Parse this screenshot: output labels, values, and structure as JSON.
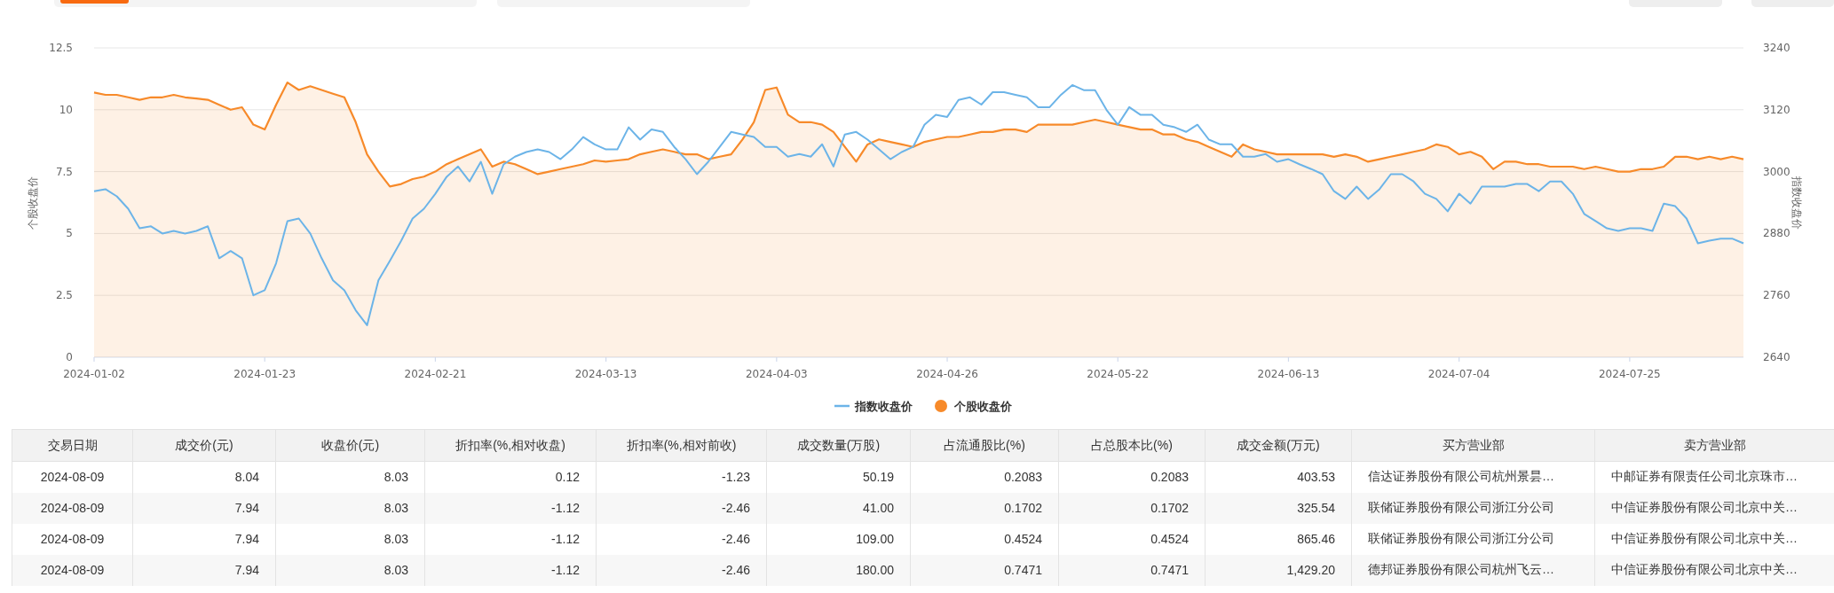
{
  "chart": {
    "chart_data": {
      "type": "line",
      "grid": true,
      "legend": "bottom",
      "ylabel": "个股收盘价",
      "y2label": "指数收盘价",
      "ylim": [
        0,
        12.5
      ],
      "y2lim": [
        2640,
        3240
      ],
      "yticks": [
        0,
        2.5,
        5,
        7.5,
        10,
        12.5
      ],
      "y2ticks": [
        2640,
        2760,
        2880,
        3000,
        3120,
        3240
      ],
      "categories": [
        "2024-01-02",
        null,
        null,
        null,
        null,
        null,
        null,
        null,
        null,
        null,
        null,
        null,
        null,
        null,
        null,
        "2024-01-23",
        null,
        null,
        null,
        null,
        null,
        null,
        null,
        null,
        null,
        null,
        null,
        null,
        null,
        null,
        "2024-02-21",
        null,
        null,
        null,
        null,
        null,
        null,
        null,
        null,
        null,
        null,
        null,
        null,
        null,
        null,
        "2024-03-13",
        null,
        null,
        null,
        null,
        null,
        null,
        null,
        null,
        null,
        null,
        null,
        null,
        null,
        null,
        "2024-04-03",
        null,
        null,
        null,
        null,
        null,
        null,
        null,
        null,
        null,
        null,
        null,
        null,
        null,
        null,
        "2024-04-26",
        null,
        null,
        null,
        null,
        null,
        null,
        null,
        null,
        null,
        null,
        null,
        null,
        null,
        null,
        "2024-05-22",
        null,
        null,
        null,
        null,
        null,
        null,
        null,
        null,
        null,
        null,
        null,
        null,
        null,
        null,
        "2024-06-13",
        null,
        null,
        null,
        null,
        null,
        null,
        null,
        null,
        null,
        null,
        null,
        null,
        null,
        null,
        "2024-07-04",
        null,
        null,
        null,
        null,
        null,
        null,
        null,
        null,
        null,
        null,
        null,
        null,
        null,
        null,
        "2024-07-25",
        null,
        null,
        null,
        null,
        null,
        null,
        null,
        null,
        null,
        null
      ],
      "series": [
        {
          "name": "指数收盘价",
          "type": "line",
          "axis": "y2",
          "color": "#6cb4e8",
          "values": [
            2962,
            2966,
            2952,
            2928,
            2890,
            2894,
            2880,
            2885,
            2880,
            2885,
            2894,
            2832,
            2846,
            2832,
            2760,
            2770,
            2822,
            2904,
            2909,
            2880,
            2832,
            2789,
            2770,
            2731,
            2702,
            2789,
            2827,
            2866,
            2909,
            2928,
            2957,
            2990,
            3010,
            2981,
            3019,
            2957,
            3014,
            3029,
            3038,
            3043,
            3038,
            3024,
            3043,
            3067,
            3053,
            3043,
            3043,
            3086,
            3062,
            3082,
            3077,
            3048,
            3024,
            2995,
            3019,
            3048,
            3077,
            3072,
            3067,
            3048,
            3048,
            3029,
            3034,
            3029,
            3053,
            3010,
            3072,
            3077,
            3062,
            3043,
            3024,
            3038,
            3048,
            3091,
            3110,
            3106,
            3139,
            3144,
            3130,
            3154,
            3154,
            3149,
            3144,
            3125,
            3125,
            3149,
            3168,
            3158,
            3158,
            3120,
            3091,
            3125,
            3110,
            3110,
            3091,
            3086,
            3077,
            3091,
            3062,
            3053,
            3053,
            3029,
            3029,
            3034,
            3019,
            3024,
            3014,
            3005,
            2995,
            2962,
            2947,
            2971,
            2947,
            2966,
            2995,
            2995,
            2981,
            2957,
            2947,
            2923,
            2957,
            2938,
            2971,
            2971,
            2971,
            2976,
            2976,
            2962,
            2981,
            2981,
            2957,
            2918,
            2904,
            2890,
            2885,
            2890,
            2890,
            2885,
            2938,
            2933,
            2909,
            2861,
            2866,
            2870,
            2870,
            2861
          ]
        },
        {
          "name": "个股收盘价",
          "type": "area",
          "color": "#f78a2a",
          "values": [
            10.7,
            10.6,
            10.6,
            10.5,
            10.4,
            10.5,
            10.5,
            10.6,
            10.5,
            10.45,
            10.4,
            10.2,
            10.0,
            10.1,
            9.4,
            9.2,
            10.2,
            11.1,
            10.8,
            10.95,
            10.8,
            10.65,
            10.5,
            9.5,
            8.2,
            7.5,
            6.9,
            7.0,
            7.2,
            7.3,
            7.5,
            7.8,
            8.0,
            8.2,
            8.4,
            7.7,
            7.9,
            7.8,
            7.6,
            7.4,
            7.5,
            7.6,
            7.7,
            7.8,
            7.95,
            7.9,
            7.95,
            8.0,
            8.2,
            8.3,
            8.4,
            8.3,
            8.2,
            8.2,
            8.0,
            8.1,
            8.2,
            8.8,
            9.5,
            10.8,
            10.9,
            9.8,
            9.5,
            9.5,
            9.4,
            9.1,
            8.5,
            7.9,
            8.6,
            8.8,
            8.7,
            8.6,
            8.5,
            8.7,
            8.8,
            8.9,
            8.9,
            9.0,
            9.1,
            9.1,
            9.2,
            9.2,
            9.1,
            9.4,
            9.4,
            9.4,
            9.4,
            9.5,
            9.6,
            9.5,
            9.4,
            9.3,
            9.2,
            9.2,
            9.0,
            9.0,
            8.8,
            8.7,
            8.5,
            8.3,
            8.1,
            8.6,
            8.4,
            8.3,
            8.2,
            8.2,
            8.2,
            8.2,
            8.2,
            8.1,
            8.2,
            8.1,
            7.9,
            8.0,
            8.1,
            8.2,
            8.3,
            8.4,
            8.6,
            8.5,
            8.2,
            8.3,
            8.1,
            7.6,
            7.9,
            7.9,
            7.8,
            7.8,
            7.7,
            7.7,
            7.7,
            7.6,
            7.7,
            7.6,
            7.5,
            7.5,
            7.6,
            7.6,
            7.7,
            8.1,
            8.1,
            8.0,
            8.1,
            8.0,
            8.1,
            8.0
          ]
        }
      ]
    }
  },
  "table": {
    "columns": [
      "交易日期",
      "成交价(元)",
      "收盘价(元)",
      "折扣率(%,相对收盘)",
      "折扣率(%,相对前收)",
      "成交数量(万股)",
      "占流通股比(%)",
      "占总股本比(%)",
      "成交金额(万元)",
      "买方营业部",
      "卖方营业部"
    ],
    "rows": [
      [
        "2024-08-09",
        "8.04",
        "8.03",
        "0.12",
        "-1.23",
        "50.19",
        "0.2083",
        "0.2083",
        "403.53",
        "信达证券股份有限公司杭州景昙…",
        "中邮证券有限责任公司北京珠市…"
      ],
      [
        "2024-08-09",
        "7.94",
        "8.03",
        "-1.12",
        "-2.46",
        "41.00",
        "0.1702",
        "0.1702",
        "325.54",
        "联储证券股份有限公司浙江分公司",
        "中信证券股份有限公司北京中关…"
      ],
      [
        "2024-08-09",
        "7.94",
        "8.03",
        "-1.12",
        "-2.46",
        "109.00",
        "0.4524",
        "0.4524",
        "865.46",
        "联储证券股份有限公司浙江分公司",
        "中信证券股份有限公司北京中关…"
      ],
      [
        "2024-08-09",
        "7.94",
        "8.03",
        "-1.12",
        "-2.46",
        "180.00",
        "0.7471",
        "0.7471",
        "1,429.20",
        "德邦证券股份有限公司杭州飞云…",
        "中信证券股份有限公司北京中关…"
      ]
    ]
  }
}
